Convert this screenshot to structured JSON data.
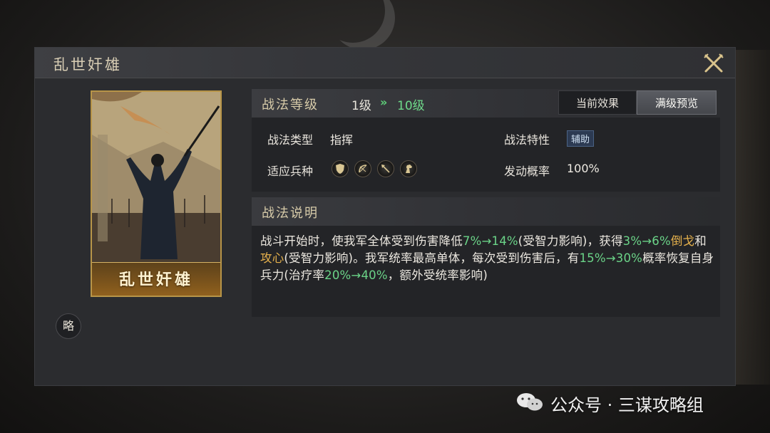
{
  "dialog": {
    "title": "乱世奸雄"
  },
  "card": {
    "name": "乱世奸雄"
  },
  "badge": {
    "label": "略"
  },
  "level": {
    "label": "战法等级",
    "from": "1级",
    "arrow": "»",
    "to": "10级"
  },
  "tabs": [
    {
      "label": "当前效果",
      "selected": false
    },
    {
      "label": "满级预览",
      "selected": true
    }
  ],
  "attributes": {
    "type_label": "战法类型",
    "type_value": "指挥",
    "trait_label": "战法特性",
    "trait_value": "辅助",
    "troops_label": "适应兵种",
    "troops": [
      "shield-icon",
      "bow-icon",
      "spear-icon",
      "horse-icon"
    ],
    "prob_label": "发动概率",
    "prob_value": "100%"
  },
  "description": {
    "title": "战法说明",
    "segments": [
      {
        "text": "战斗开始时，使我军全体受到伤害降低",
        "color": "white"
      },
      {
        "text": "7%→14%",
        "color": "green"
      },
      {
        "text": "(受智力影响)，获得",
        "color": "white"
      },
      {
        "text": "3%→6%",
        "color": "green"
      },
      {
        "text": "倒戈",
        "color": "orange"
      },
      {
        "text": "和",
        "color": "white"
      },
      {
        "text": "攻心",
        "color": "orange"
      },
      {
        "text": "(受智力影响)。我军统率最高单体，每次受到伤害后，有",
        "color": "white"
      },
      {
        "text": "15%→30%",
        "color": "green"
      },
      {
        "text": "概率恢复自身兵力(治疗率",
        "color": "white"
      },
      {
        "text": "20%→40%",
        "color": "green"
      },
      {
        "text": "，额外受统率影响)",
        "color": "white"
      }
    ]
  },
  "watermark": {
    "text": "公众号 · 三谋攻略组"
  },
  "colors": {
    "green": "#6bd488",
    "orange": "#e4b04c",
    "gold": "#b89548"
  }
}
